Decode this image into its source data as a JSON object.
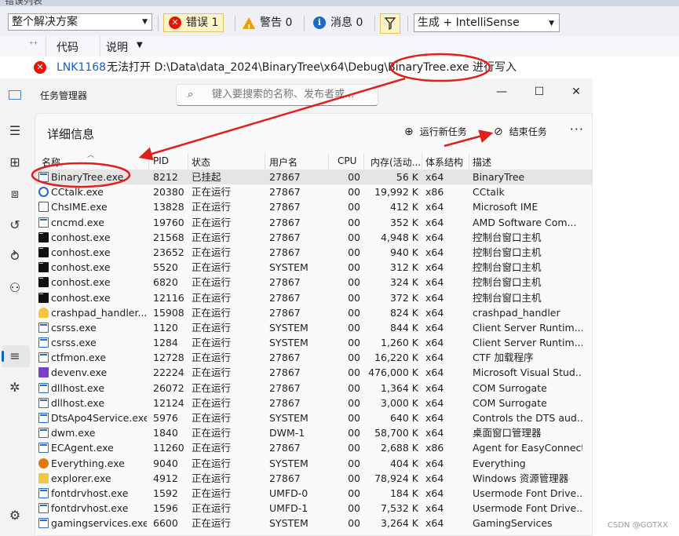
{
  "vs": {
    "top_strip_text": "错误列表",
    "scope": "整个解决方案",
    "errors": "错误 1",
    "warnings": "警告 0",
    "messages": "消息 0",
    "build_filter": "生成 + IntelliSense",
    "col_code": "代码",
    "col_desc": "说明",
    "error_row": {
      "code": "LNK1168",
      "desc": "无法打开 D:\\Data\\data_2024\\BinaryTree\\x64\\Debug\\BinaryTree.exe 进行写入"
    }
  },
  "tm": {
    "app_title": "任务管理器",
    "search_placeholder": "键入要搜索的名称、发布者或...",
    "page_title": "详细信息",
    "run_new_task": "运行新任务",
    "end_task": "结束任务",
    "more": "···",
    "columns": [
      "名称",
      "PID",
      "状态",
      "用户名",
      "CPU",
      "内存(活动...",
      "体系结构",
      "描述"
    ],
    "rows": [
      {
        "icon": "win",
        "name": "BinaryTree.exe",
        "pid": "8212",
        "status": "已挂起",
        "user": "27867",
        "cpu": "00",
        "mem": "56 K",
        "arch": "x64",
        "desc": "BinaryTree",
        "selected": true
      },
      {
        "icon": "cc",
        "name": "CCtalk.exe",
        "pid": "20380",
        "status": "正在运行",
        "user": "27867",
        "cpu": "00",
        "mem": "19,992 K",
        "arch": "x86",
        "desc": "CCtalk"
      },
      {
        "icon": "ime",
        "name": "ChsIME.exe",
        "pid": "13828",
        "status": "正在运行",
        "user": "27867",
        "cpu": "00",
        "mem": "412 K",
        "arch": "x64",
        "desc": "Microsoft IME"
      },
      {
        "icon": "win",
        "name": "cncmd.exe",
        "pid": "19760",
        "status": "正在运行",
        "user": "27867",
        "cpu": "00",
        "mem": "352 K",
        "arch": "x64",
        "desc": "AMD Software Com..."
      },
      {
        "icon": "con",
        "name": "conhost.exe",
        "pid": "21568",
        "status": "正在运行",
        "user": "27867",
        "cpu": "00",
        "mem": "4,948 K",
        "arch": "x64",
        "desc": "控制台窗口主机"
      },
      {
        "icon": "con",
        "name": "conhost.exe",
        "pid": "23652",
        "status": "正在运行",
        "user": "27867",
        "cpu": "00",
        "mem": "940 K",
        "arch": "x64",
        "desc": "控制台窗口主机"
      },
      {
        "icon": "con",
        "name": "conhost.exe",
        "pid": "5520",
        "status": "正在运行",
        "user": "SYSTEM",
        "cpu": "00",
        "mem": "312 K",
        "arch": "x64",
        "desc": "控制台窗口主机"
      },
      {
        "icon": "con",
        "name": "conhost.exe",
        "pid": "6820",
        "status": "正在运行",
        "user": "27867",
        "cpu": "00",
        "mem": "324 K",
        "arch": "x64",
        "desc": "控制台窗口主机"
      },
      {
        "icon": "con",
        "name": "conhost.exe",
        "pid": "12116",
        "status": "正在运行",
        "user": "27867",
        "cpu": "00",
        "mem": "372 K",
        "arch": "x64",
        "desc": "控制台窗口主机"
      },
      {
        "icon": "crash",
        "name": "crashpad_handler....",
        "pid": "15908",
        "status": "正在运行",
        "user": "27867",
        "cpu": "00",
        "mem": "824 K",
        "arch": "x64",
        "desc": "crashpad_handler"
      },
      {
        "icon": "win",
        "name": "csrss.exe",
        "pid": "1120",
        "status": "正在运行",
        "user": "SYSTEM",
        "cpu": "00",
        "mem": "844 K",
        "arch": "x64",
        "desc": "Client Server Runtim..."
      },
      {
        "icon": "win",
        "name": "csrss.exe",
        "pid": "1284",
        "status": "正在运行",
        "user": "SYSTEM",
        "cpu": "00",
        "mem": "1,260 K",
        "arch": "x64",
        "desc": "Client Server Runtim..."
      },
      {
        "icon": "win",
        "name": "ctfmon.exe",
        "pid": "12728",
        "status": "正在运行",
        "user": "27867",
        "cpu": "00",
        "mem": "16,220 K",
        "arch": "x64",
        "desc": "CTF 加载程序"
      },
      {
        "icon": "vs",
        "name": "devenv.exe",
        "pid": "22224",
        "status": "正在运行",
        "user": "27867",
        "cpu": "00",
        "mem": "476,000 K",
        "arch": "x64",
        "desc": "Microsoft Visual Stud..."
      },
      {
        "icon": "win",
        "name": "dllhost.exe",
        "pid": "26072",
        "status": "正在运行",
        "user": "27867",
        "cpu": "00",
        "mem": "1,364 K",
        "arch": "x64",
        "desc": "COM Surrogate"
      },
      {
        "icon": "win",
        "name": "dllhost.exe",
        "pid": "12124",
        "status": "正在运行",
        "user": "27867",
        "cpu": "00",
        "mem": "3,000 K",
        "arch": "x64",
        "desc": "COM Surrogate"
      },
      {
        "icon": "win",
        "name": "DtsApo4Service.exe",
        "pid": "5976",
        "status": "正在运行",
        "user": "SYSTEM",
        "cpu": "00",
        "mem": "640 K",
        "arch": "x64",
        "desc": "Controls the DTS aud..."
      },
      {
        "icon": "win",
        "name": "dwm.exe",
        "pid": "1840",
        "status": "正在运行",
        "user": "DWM-1",
        "cpu": "00",
        "mem": "58,700 K",
        "arch": "x64",
        "desc": "桌面窗口管理器"
      },
      {
        "icon": "win",
        "name": "ECAgent.exe",
        "pid": "11260",
        "status": "正在运行",
        "user": "27867",
        "cpu": "00",
        "mem": "2,688 K",
        "arch": "x86",
        "desc": "Agent for EasyConnect"
      },
      {
        "icon": "every",
        "name": "Everything.exe",
        "pid": "9040",
        "status": "正在运行",
        "user": "SYSTEM",
        "cpu": "00",
        "mem": "404 K",
        "arch": "x64",
        "desc": "Everything"
      },
      {
        "icon": "folder",
        "name": "explorer.exe",
        "pid": "4912",
        "status": "正在运行",
        "user": "27867",
        "cpu": "00",
        "mem": "78,924 K",
        "arch": "x64",
        "desc": "Windows 资源管理器"
      },
      {
        "icon": "win",
        "name": "fontdrvhost.exe",
        "pid": "1592",
        "status": "正在运行",
        "user": "UMFD-0",
        "cpu": "00",
        "mem": "184 K",
        "arch": "x64",
        "desc": "Usermode Font Drive..."
      },
      {
        "icon": "win",
        "name": "fontdrvhost.exe",
        "pid": "1596",
        "status": "正在运行",
        "user": "UMFD-1",
        "cpu": "00",
        "mem": "7,532 K",
        "arch": "x64",
        "desc": "Usermode Font Drive..."
      },
      {
        "icon": "win",
        "name": "gamingservices.exe",
        "pid": "6600",
        "status": "正在运行",
        "user": "SYSTEM",
        "cpu": "00",
        "mem": "3,264 K",
        "arch": "x64",
        "desc": "GamingServices"
      }
    ]
  },
  "watermark": "CSDN @GOTXX",
  "colors": {
    "annotation_red": "#e0201b",
    "accent_blue": "#0067c0",
    "error_red": "#e51400"
  }
}
